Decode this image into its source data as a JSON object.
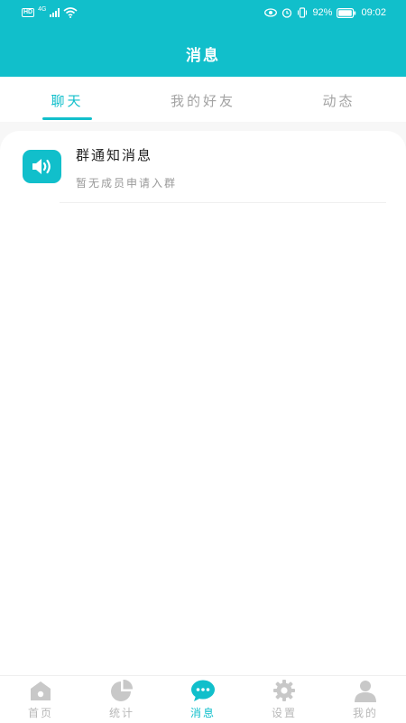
{
  "status_bar": {
    "hd": "HD",
    "network": "4G",
    "battery": "92%",
    "time": "09:02"
  },
  "header": {
    "title": "消息"
  },
  "tabs": [
    {
      "label": "聊天",
      "active": true
    },
    {
      "label": "我的好友",
      "active": false
    },
    {
      "label": "动态",
      "active": false
    }
  ],
  "messages": [
    {
      "icon": "speaker-icon",
      "title": "群通知消息",
      "subtitle": "暂无成员申请入群"
    }
  ],
  "tabbar": [
    {
      "label": "首页",
      "icon": "home-icon",
      "active": false
    },
    {
      "label": "统计",
      "icon": "pie-chart-icon",
      "active": false
    },
    {
      "label": "消息",
      "icon": "chat-bubble-icon",
      "active": true
    },
    {
      "label": "设置",
      "icon": "gear-icon",
      "active": false
    },
    {
      "label": "我的",
      "icon": "user-icon",
      "active": false
    }
  ],
  "colors": {
    "accent": "#11bfcb",
    "inactive_tab": "#a3a3a3",
    "tabbar_inactive": "#b8b8b8",
    "background": "#f7f7f7"
  }
}
